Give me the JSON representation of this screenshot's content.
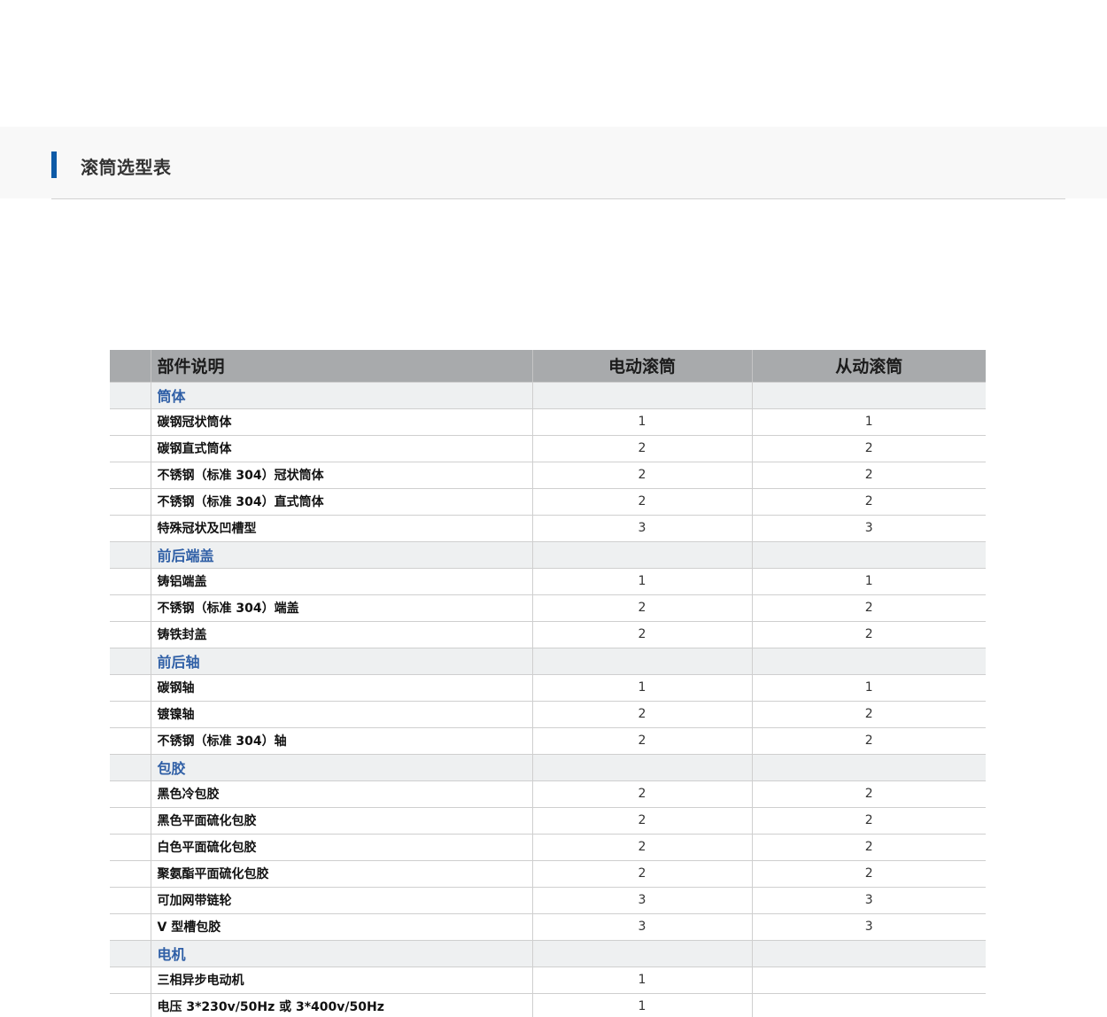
{
  "section": {
    "title": "滚筒选型表"
  },
  "table": {
    "headers": {
      "part": "部件说明",
      "powered": "电动滚筒",
      "driven": "从动滚筒"
    },
    "rows": [
      {
        "type": "category",
        "name": "筒体"
      },
      {
        "type": "item",
        "name": "碳钢冠状筒体",
        "powered": "1",
        "driven": "1"
      },
      {
        "type": "item",
        "name": "碳钢直式筒体",
        "powered": "2",
        "driven": "2"
      },
      {
        "type": "item",
        "name": "不锈钢（标准 304）冠状筒体",
        "powered": "2",
        "driven": "2"
      },
      {
        "type": "item",
        "name": "不锈钢（标准 304）直式筒体",
        "powered": "2",
        "driven": "2"
      },
      {
        "type": "item",
        "name": "特殊冠状及凹槽型",
        "powered": "3",
        "driven": "3"
      },
      {
        "type": "category",
        "name": "前后端盖"
      },
      {
        "type": "item",
        "name": "铸铝端盖",
        "powered": "1",
        "driven": "1"
      },
      {
        "type": "item",
        "name": "不锈钢（标准 304）端盖",
        "powered": "2",
        "driven": "2"
      },
      {
        "type": "item",
        "name": "铸铁封盖",
        "powered": "2",
        "driven": "2"
      },
      {
        "type": "category",
        "name": "前后轴"
      },
      {
        "type": "item",
        "name": "碳钢轴",
        "powered": "1",
        "driven": "1"
      },
      {
        "type": "item",
        "name": "镀镍轴",
        "powered": "2",
        "driven": "2"
      },
      {
        "type": "item",
        "name": "不锈钢（标准 304）轴",
        "powered": "2",
        "driven": "2"
      },
      {
        "type": "category",
        "name": "包胶"
      },
      {
        "type": "item",
        "name": "黑色冷包胶",
        "powered": "2",
        "driven": "2"
      },
      {
        "type": "item",
        "name": "黑色平面硫化包胶",
        "powered": "2",
        "driven": "2"
      },
      {
        "type": "item",
        "name": "白色平面硫化包胶",
        "powered": "2",
        "driven": "2"
      },
      {
        "type": "item",
        "name": "聚氨酯平面硫化包胶",
        "powered": "2",
        "driven": "2"
      },
      {
        "type": "item",
        "name": "可加网带链轮",
        "powered": "3",
        "driven": "3"
      },
      {
        "type": "item",
        "name": "V 型槽包胶",
        "powered": "3",
        "driven": "3"
      },
      {
        "type": "category",
        "name": "电机"
      },
      {
        "type": "item",
        "name": "三相异步电动机",
        "powered": "1",
        "driven": ""
      },
      {
        "type": "item",
        "name": "电压 3*230v/50Hz 或 3*400v/50Hz",
        "powered": "1",
        "driven": ""
      }
    ]
  },
  "colors": {
    "accent": "#0d5aa7",
    "category_text": "#2f5fa6",
    "header_bg": "#a8aaac",
    "category_bg": "#eef0f1"
  }
}
